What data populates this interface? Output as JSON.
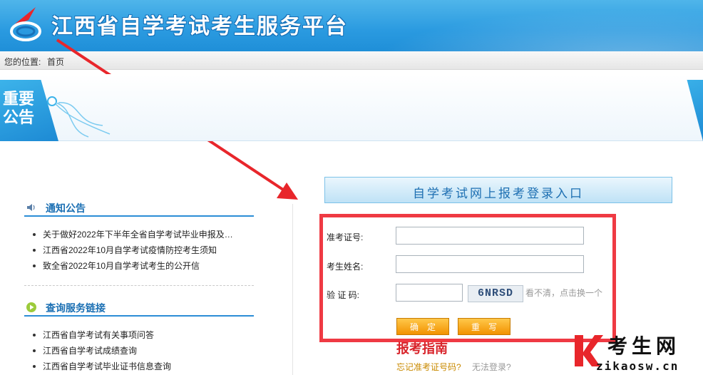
{
  "header": {
    "title": "江西省自学考试考生服务平台"
  },
  "breadcrumb": {
    "label": "您的位置:",
    "current": "首页"
  },
  "banner": {
    "line1": "重要",
    "line2": "公告"
  },
  "notices": {
    "title": "通知公告",
    "items": [
      "关于做好2022年下半年全省自学考试毕业申报及…",
      "江西省2022年10月自学考试疫情防控考生须知",
      "致全省2022年10月自学考试考生的公开信"
    ]
  },
  "links": {
    "title": "查询服务链接",
    "items": [
      "江西省自学考试有关事项问答",
      "江西省自学考试成绩查询",
      "江西省自学考试毕业证书信息查询"
    ]
  },
  "login": {
    "title": "自学考试网上报考登录入口",
    "id_label": "准考证号:",
    "id_value": "",
    "name_label": "考生姓名:",
    "name_value": "",
    "captcha_label": "验 证 码:",
    "captcha_value": "",
    "captcha_code": "6NRSD",
    "captcha_tip": "看不清，点击换一个",
    "confirm": "确定",
    "reset": "重写",
    "guide": "报考指南",
    "forgot": "忘记准考证号码?",
    "cannot_login": "无法登录?"
  },
  "watermark": {
    "cn": "考生网",
    "en": "zikaosw.cn"
  },
  "colors": {
    "header": "#2a9ae0",
    "accent": "#2b8dd6",
    "highlight": "#ef3a43",
    "button": "#f29200"
  }
}
